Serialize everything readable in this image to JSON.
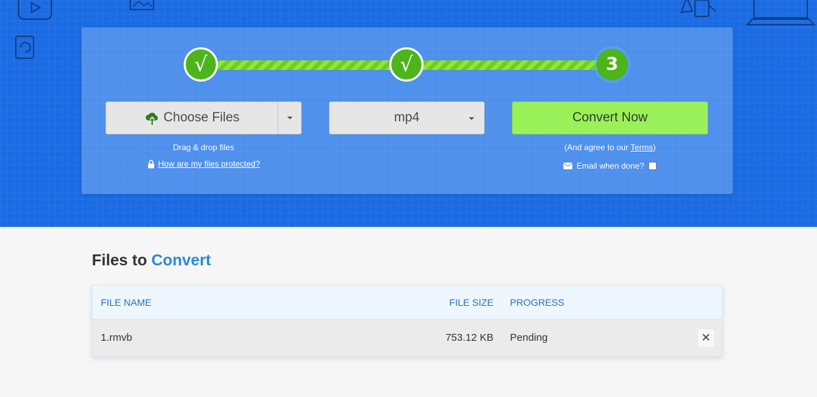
{
  "steps": [
    {
      "state": "done",
      "glyph": "√"
    },
    {
      "state": "done",
      "glyph": "√"
    },
    {
      "state": "current",
      "label": "3"
    }
  ],
  "upload": {
    "choose_label": "Choose Files",
    "drag_hint": "Drag & drop files",
    "protect_link": "How are my files protected?"
  },
  "format": {
    "selected": "mp4"
  },
  "convert": {
    "label": "Convert Now",
    "agree_prefix": "(And agree to our ",
    "terms_link": "Terms",
    "agree_suffix": ")",
    "email_label": "Email when done?"
  },
  "files_section": {
    "title_prefix": "Files to",
    "title_accent": "Convert",
    "columns": {
      "name": "FILE NAME",
      "size": "FILE SIZE",
      "progress": "PROGRESS"
    },
    "rows": [
      {
        "name": "1.rmvb",
        "size": "753.12 KB",
        "progress": "Pending",
        "remove_glyph": "✕"
      }
    ]
  },
  "colors": {
    "hero_bg": "#1b6be3",
    "step_green": "#4bb51b",
    "convert_button": "#9bf15a",
    "accent_blue": "#2b87dd"
  },
  "icons": [
    "cloud-upload-icon",
    "lock-icon",
    "envelope-icon",
    "chevron-down-icon",
    "close-icon",
    "checkmark-icon"
  ]
}
